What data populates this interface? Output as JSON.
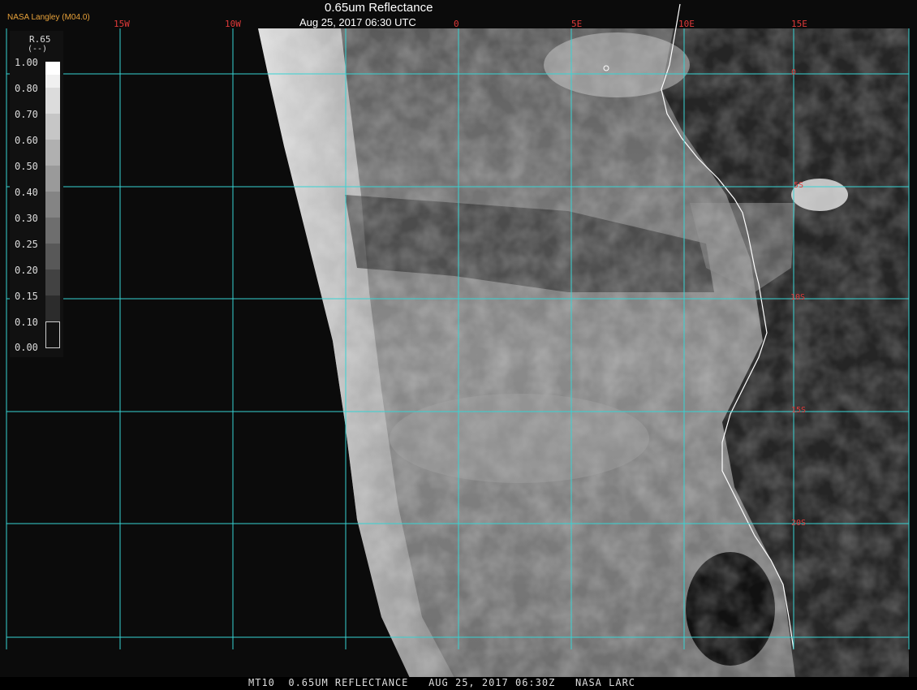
{
  "header": {
    "title": "0.65um Reflectance",
    "datetime": "Aug 25, 2017 06:30 UTC",
    "agency": "NASA Langley (M04.0)"
  },
  "grid": {
    "lon_labels": [
      "15W",
      "10W",
      "0",
      "5E",
      "10E",
      "15E"
    ],
    "lat_labels": [
      "0",
      "5S",
      "10S",
      "15S",
      "20S"
    ]
  },
  "legend": {
    "title": "R.65",
    "unit": "(--)",
    "ticks": [
      "1.00",
      "0.80",
      "0.70",
      "0.60",
      "0.50",
      "0.40",
      "0.30",
      "0.25",
      "0.20",
      "0.15",
      "0.10",
      "0.00"
    ]
  },
  "footer": {
    "text": "MT10  0.65UM REFLECTANCE   AUG 25, 2017 06:30Z   NASA LARC"
  },
  "colors": {
    "grid_line": "#37d3d3",
    "label_red": "#e03a3a",
    "agency_orange": "#e8a23a",
    "coastline": "#ffffff"
  }
}
